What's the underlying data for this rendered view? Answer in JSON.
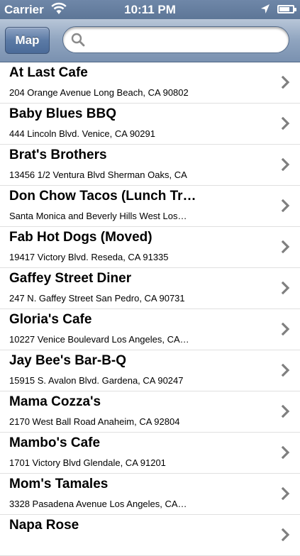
{
  "status_bar": {
    "carrier": "Carrier",
    "time": "10:11 PM",
    "icons": [
      "wifi-icon",
      "location-arrow-icon",
      "battery-icon"
    ]
  },
  "toolbar": {
    "map_label": "Map",
    "search": {
      "placeholder": "",
      "value": ""
    }
  },
  "restaurants": [
    {
      "name": "At Last Cafe",
      "address": "204 Orange Avenue Long Beach, CA 90802"
    },
    {
      "name": "Baby Blues BBQ",
      "address": "444 Lincoln Blvd. Venice, CA 90291"
    },
    {
      "name": "Brat's Brothers",
      "address": "13456 1/2 Ventura Blvd Sherman Oaks, CA"
    },
    {
      "name": "Don Chow Tacos (Lunch Tr…",
      "address": "Santa Monica and Beverly Hills West Los…"
    },
    {
      "name": "Fab Hot Dogs (Moved)",
      "address": "19417 Victory Blvd. Reseda, CA 91335"
    },
    {
      "name": "Gaffey Street Diner",
      "address": "247 N. Gaffey Street San Pedro, CA 90731"
    },
    {
      "name": "Gloria's Cafe",
      "address": "10227 Venice Boulevard Los Angeles, CA…"
    },
    {
      "name": "Jay Bee's Bar-B-Q",
      "address": "15915 S. Avalon Blvd. Gardena, CA 90247"
    },
    {
      "name": "Mama Cozza's",
      "address": "2170 West Ball Road Anaheim, CA 92804"
    },
    {
      "name": "Mambo's Cafe",
      "address": "1701 Victory Blvd Glendale, CA 91201"
    },
    {
      "name": "Mom's Tamales",
      "address": "3328 Pasadena Avenue Los Angeles, CA…"
    },
    {
      "name": "Napa Rose",
      "address": ""
    }
  ],
  "colors": {
    "status_bar": "#647d9e",
    "toolbar": "#8fa4bf",
    "map_button": "#5b7aa5",
    "chevron": "#7f7f7f",
    "separator": "#e0e0e0"
  }
}
